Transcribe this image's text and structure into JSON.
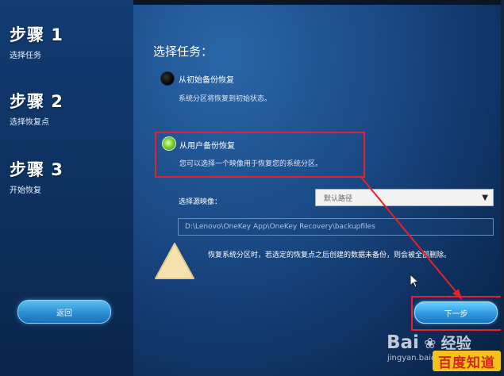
{
  "steps": [
    {
      "title": "步骤 1",
      "subtitle": "选择任务"
    },
    {
      "title": "步骤 2",
      "subtitle": "选择恢复点"
    },
    {
      "title": "步骤 3",
      "subtitle": "开始恢复"
    }
  ],
  "heading": "选择任务：",
  "options": [
    {
      "label": "从初始备份恢复",
      "description": "系统分区将恢复到初始状态。",
      "selected": false
    },
    {
      "label": "从用户备份恢复",
      "description": "您可以选择一个映像用于恢复您的系统分区。",
      "selected": true
    }
  ],
  "image_select": {
    "label": "选择源映像：",
    "value": "默认路径"
  },
  "path": "D:\\Lenovo\\OneKey App\\OneKey Recovery\\backupfiles",
  "warning": "恢复系统分区时，若选定的恢复点之后创建的数据未备份，则会被全部删除。",
  "buttons": {
    "back": "返回",
    "next": "下一步"
  },
  "watermark": {
    "brand": "Bai",
    "brand2": "经验",
    "url": "jingyan.baidu.com",
    "badge": "百度知道"
  },
  "colors": {
    "annotation": "#e8202a",
    "accent": "#2f99e0"
  },
  "icons": {
    "warning": "warning-triangle-icon",
    "cursor": "mouse-cursor-icon",
    "dropdown": "chevron-down-icon"
  }
}
